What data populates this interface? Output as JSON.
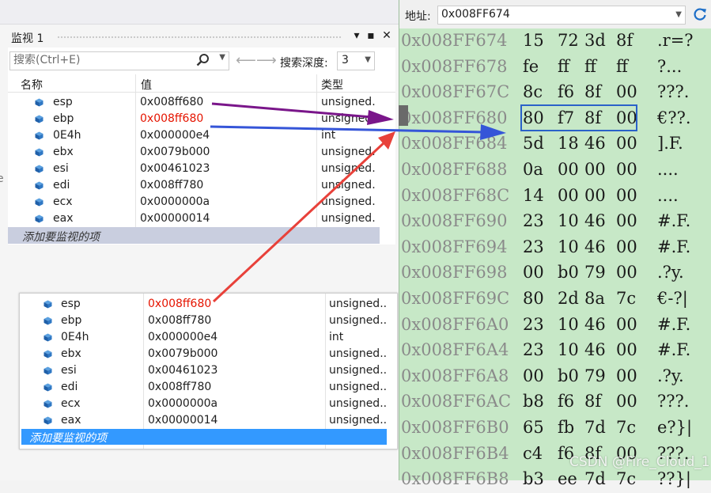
{
  "watch": {
    "title": "监视 1",
    "title_buttons": [
      "▾",
      "▪",
      "✕"
    ],
    "search_placeholder": "搜索(Ctrl+E)",
    "depth_label": "搜索深度:",
    "depth_value": "3",
    "headers": {
      "name": "名称",
      "value": "值",
      "type": "类型"
    },
    "rows": [
      {
        "name": "esp",
        "value": "0x008ff680",
        "type": "unsigned...",
        "changed": false
      },
      {
        "name": "ebp",
        "value": "0x008ff680",
        "type": "unsigned...",
        "changed": true
      },
      {
        "name": "0E4h",
        "value": "0x000000e4",
        "type": "int",
        "changed": false
      },
      {
        "name": "ebx",
        "value": "0x0079b000",
        "type": "unsigned...",
        "changed": false
      },
      {
        "name": "esi",
        "value": "0x00461023",
        "type": "unsigned...",
        "changed": false
      },
      {
        "name": "edi",
        "value": "0x008ff780",
        "type": "unsigned...",
        "changed": false
      },
      {
        "name": "ecx",
        "value": "0x0000000a",
        "type": "unsigned...",
        "changed": false
      },
      {
        "name": "eax",
        "value": "0x00000014",
        "type": "unsigned...",
        "changed": false
      }
    ],
    "add_item": "添加要监视的项"
  },
  "watch2": {
    "rows": [
      {
        "name": "esp",
        "value": "0x008ff680",
        "type": "unsigned...",
        "changed": true
      },
      {
        "name": "ebp",
        "value": "0x008ff780",
        "type": "unsigned...",
        "changed": false
      },
      {
        "name": "0E4h",
        "value": "0x000000e4",
        "type": "int",
        "changed": false
      },
      {
        "name": "ebx",
        "value": "0x0079b000",
        "type": "unsigned...",
        "changed": false
      },
      {
        "name": "esi",
        "value": "0x00461023",
        "type": "unsigned...",
        "changed": false
      },
      {
        "name": "edi",
        "value": "0x008ff780",
        "type": "unsigned...",
        "changed": false
      },
      {
        "name": "ecx",
        "value": "0x0000000a",
        "type": "unsigned...",
        "changed": false
      },
      {
        "name": "eax",
        "value": "0x00000014",
        "type": "unsigned...",
        "changed": false
      }
    ],
    "add_item": "添加要监视的项"
  },
  "memory": {
    "address_label": "地址:",
    "address_value": "0x008FF674",
    "rows": [
      {
        "addr": "0x008FF674",
        "bytes": [
          "15",
          "72",
          "3d",
          "8f"
        ],
        "chars": ".r=?"
      },
      {
        "addr": "0x008FF678",
        "bytes": [
          "fe",
          "ff",
          "ff",
          "ff"
        ],
        "chars": "?..."
      },
      {
        "addr": "0x008FF67C",
        "bytes": [
          "8c",
          "f6",
          "8f",
          "00"
        ],
        "chars": "???."
      },
      {
        "addr": "0x008FF680",
        "bytes": [
          "80",
          "f7",
          "8f",
          "00"
        ],
        "chars": "€??."
      },
      {
        "addr": "0x008FF684",
        "bytes": [
          "5d",
          "18",
          "46",
          "00"
        ],
        "chars": "].F."
      },
      {
        "addr": "0x008FF688",
        "bytes": [
          "0a",
          "00",
          "00",
          "00"
        ],
        "chars": "...."
      },
      {
        "addr": "0x008FF68C",
        "bytes": [
          "14",
          "00",
          "00",
          "00"
        ],
        "chars": "...."
      },
      {
        "addr": "0x008FF690",
        "bytes": [
          "23",
          "10",
          "46",
          "00"
        ],
        "chars": "#.F."
      },
      {
        "addr": "0x008FF694",
        "bytes": [
          "23",
          "10",
          "46",
          "00"
        ],
        "chars": "#.F."
      },
      {
        "addr": "0x008FF698",
        "bytes": [
          "00",
          "b0",
          "79",
          "00"
        ],
        "chars": ".?y."
      },
      {
        "addr": "0x008FF69C",
        "bytes": [
          "80",
          "2d",
          "8a",
          "7c"
        ],
        "chars": "€-?|"
      },
      {
        "addr": "0x008FF6A0",
        "bytes": [
          "23",
          "10",
          "46",
          "00"
        ],
        "chars": "#.F."
      },
      {
        "addr": "0x008FF6A4",
        "bytes": [
          "23",
          "10",
          "46",
          "00"
        ],
        "chars": "#.F."
      },
      {
        "addr": "0x008FF6A8",
        "bytes": [
          "00",
          "b0",
          "79",
          "00"
        ],
        "chars": ".?y."
      },
      {
        "addr": "0x008FF6AC",
        "bytes": [
          "b8",
          "f6",
          "8f",
          "00"
        ],
        "chars": "???."
      },
      {
        "addr": "0x008FF6B0",
        "bytes": [
          "65",
          "fb",
          "7d",
          "7c"
        ],
        "chars": "e?}|"
      },
      {
        "addr": "0x008FF6B4",
        "bytes": [
          "c4",
          "f6",
          "8f",
          "00"
        ],
        "chars": "???."
      },
      {
        "addr": "0x008FF6B8",
        "bytes": [
          "b3",
          "ee",
          "7d",
          "7c"
        ],
        "chars": "??}|"
      }
    ]
  },
  "watermark": "CSDN @Fire_Cloud_1",
  "colors": {
    "changed_value": "#e51400",
    "memory_bg": "#c7e8c7",
    "highlight_box": "#2a62c9",
    "arrow_purple": "#7a168a",
    "arrow_blue": "#3555d8",
    "arrow_red": "#e8413a",
    "add_row_selected": "#3399ff"
  }
}
